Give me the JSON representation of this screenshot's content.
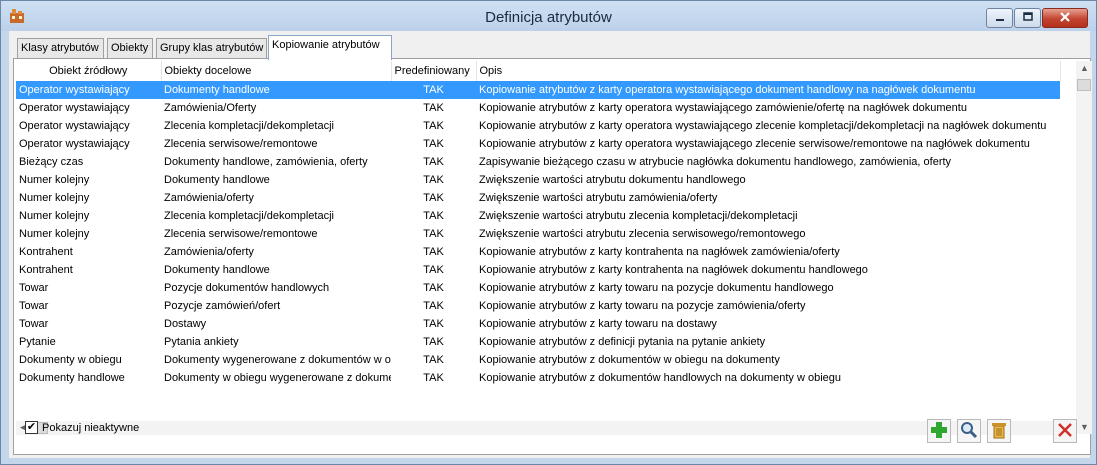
{
  "window": {
    "title": "Definicja atrybutów",
    "icon": "app-icon",
    "buttons": [
      "minimize-icon",
      "maximize-icon",
      "close-icon"
    ]
  },
  "tabs": [
    {
      "label": "Klasy atrybutów"
    },
    {
      "label": "Obiekty"
    },
    {
      "label": "Grupy klas atrybutów"
    },
    {
      "label": "Kopiowanie atrybutów",
      "active": true
    }
  ],
  "table": {
    "columns": [
      "Obiekt źródłowy",
      "Obiekty docelowe",
      "Predefiniowany",
      "Opis"
    ],
    "rows": [
      [
        "Operator wystawiający",
        "Dokumenty handlowe",
        "TAK",
        "Kopiowanie atrybutów z karty operatora wystawiającego dokument handlowy na nagłówek dokumentu"
      ],
      [
        "Operator wystawiający",
        "Zamówienia/Oferty",
        "TAK",
        "Kopiowanie atrybutów z karty operatora wystawiającego zamówienie/ofertę na nagłówek dokumentu"
      ],
      [
        "Operator wystawiający",
        "Zlecenia kompletacji/dekompletacji",
        "TAK",
        "Kopiowanie atrybutów z karty operatora wystawiającego zlecenie kompletacji/dekompletacji  na nagłówek dokumentu"
      ],
      [
        "Operator wystawiający",
        "Zlecenia serwisowe/remontowe",
        "TAK",
        "Kopiowanie atrybutów z karty operatora wystawiającego zlecenie serwisowe/remontowe na nagłówek dokumentu"
      ],
      [
        "Bieżący czas",
        "Dokumenty handlowe, zamówienia, oferty",
        "TAK",
        "Zapisywanie bieżącego czasu w atrybucie nagłówka dokumentu handlowego, zamówienia, oferty"
      ],
      [
        "Numer kolejny",
        "Dokumenty handlowe",
        "TAK",
        "Zwiększenie wartości atrybutu dokumentu handlowego"
      ],
      [
        "Numer kolejny",
        "Zamówienia/oferty",
        "TAK",
        "Zwiększenie wartości atrybutu zamówienia/oferty"
      ],
      [
        "Numer kolejny",
        "Zlecenia kompletacji/dekompletacji",
        "TAK",
        "Zwiększenie wartości atrybutu zlecenia kompletacji/dekompletacji"
      ],
      [
        "Numer kolejny",
        "Zlecenia serwisowe/remontowe",
        "TAK",
        "Zwiększenie wartości atrybutu zlecenia serwisowego/remontowego"
      ],
      [
        "Kontrahent",
        "Zamówienia/oferty",
        "TAK",
        "Kopiowanie atrybutów z karty kontrahenta na nagłówek zamówienia/oferty"
      ],
      [
        "Kontrahent",
        "Dokumenty handlowe",
        "TAK",
        "Kopiowanie atrybutów z karty kontrahenta na nagłówek dokumentu handlowego"
      ],
      [
        "Towar",
        "Pozycje dokumentów handlowych",
        "TAK",
        "Kopiowanie atrybutów z karty towaru na pozycje dokumentu handlowego"
      ],
      [
        "Towar",
        "Pozycje zamówień/ofert",
        "TAK",
        "Kopiowanie atrybutów z karty towaru na pozycje zamówienia/oferty"
      ],
      [
        "Towar",
        "Dostawy",
        "TAK",
        "Kopiowanie atrybutów z karty towaru na dostawy"
      ],
      [
        "Pytanie",
        "Pytania ankiety",
        "TAK",
        "Kopiowanie atrybutów z definicji pytania na pytanie ankiety"
      ],
      [
        "Dokumenty w obiegu",
        "Dokumenty wygenerowane z dokumentów w obiegu",
        "TAK",
        "Kopiowanie atrybutów z dokumentów w obiegu na dokumenty"
      ],
      [
        "Dokumenty handlowe",
        "Dokumenty w obiegu wygenerowane z dokumentów handlowych",
        "TAK",
        "Kopiowanie atrybutów z dokumentów handlowych na dokumenty w obiegu"
      ]
    ],
    "selected_row": 0
  },
  "checkbox": {
    "label": "Pokazuj nieaktywne",
    "checked": true
  },
  "toolbar": {
    "buttons": [
      "add-icon",
      "search-icon",
      "delete-icon",
      "close-icon"
    ]
  },
  "colors": {
    "selection": "#3399ff",
    "titlebar": "#c4d6ec",
    "add": "#2fa82f",
    "close_x": "#d0302a"
  }
}
